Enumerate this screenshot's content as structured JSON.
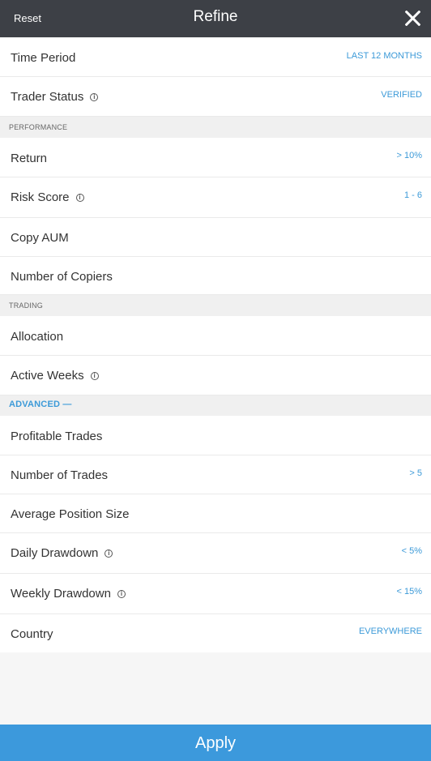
{
  "header": {
    "reset_label": "Reset",
    "title": "Refine",
    "close_icon": "close-icon"
  },
  "rows": {
    "time_period": {
      "label": "Time Period",
      "value": "LAST 12 MONTHS"
    },
    "trader_status": {
      "label": "Trader Status",
      "value": "VERIFIED"
    },
    "return": {
      "label": "Return",
      "value": "> 10%"
    },
    "risk_score": {
      "label": "Risk Score",
      "value": "1 - 6"
    },
    "copy_aum": {
      "label": "Copy AUM"
    },
    "number_of_copiers": {
      "label": "Number of Copiers"
    },
    "allocation": {
      "label": "Allocation"
    },
    "active_weeks": {
      "label": "Active Weeks"
    },
    "profitable_trades": {
      "label": "Profitable Trades"
    },
    "number_of_trades": {
      "label": "Number of Trades",
      "value": "> 5"
    },
    "average_position_size": {
      "label": "Average Position Size"
    },
    "daily_drawdown": {
      "label": "Daily Drawdown",
      "value": "< 5%"
    },
    "weekly_drawdown": {
      "label": "Weekly Drawdown",
      "value": "< 15%"
    },
    "country": {
      "label": "Country",
      "value": "EVERYWHERE"
    }
  },
  "sections": {
    "performance": "PERFORMANCE",
    "trading": "TRADING",
    "advanced": "ADVANCED —"
  },
  "info_glyph": "i",
  "apply_label": "Apply",
  "colors": {
    "header_bg": "#3d4046",
    "accent": "#3c9ad8",
    "apply_bg": "#3c99dc"
  }
}
